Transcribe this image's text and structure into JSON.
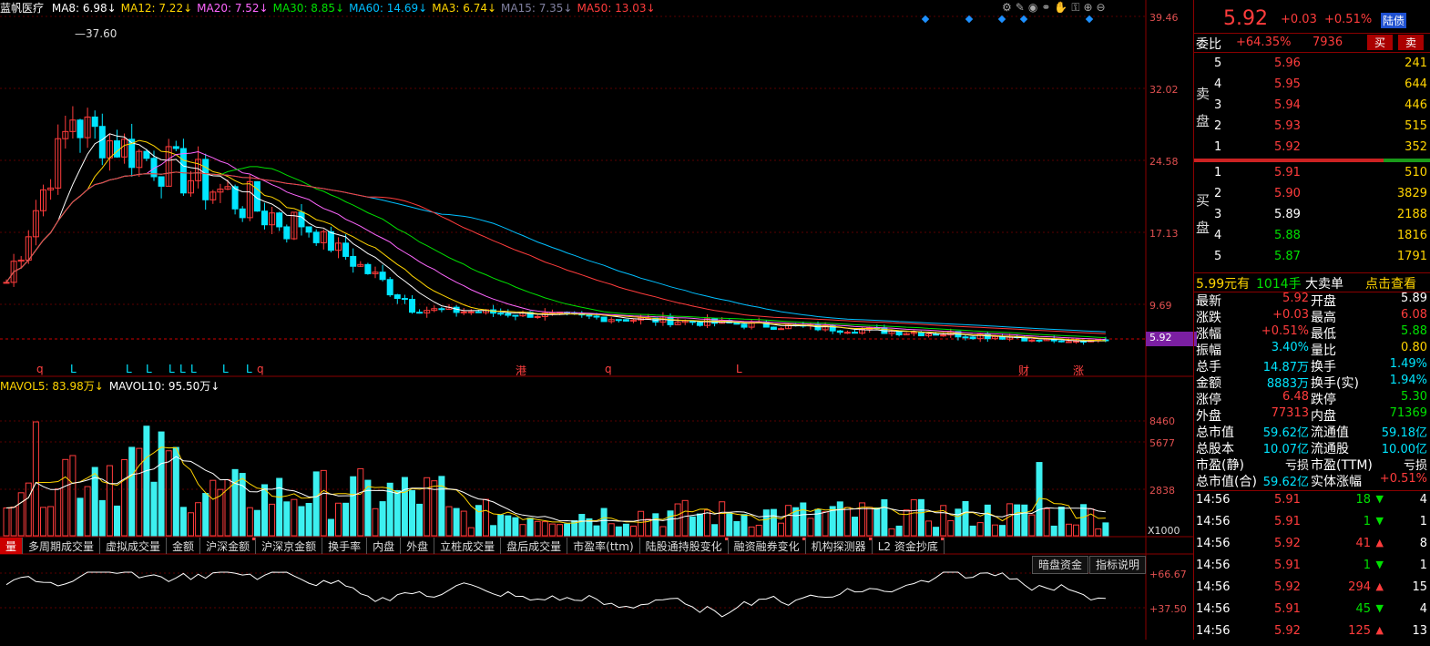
{
  "ma_bar": {
    "stock": "蓝帆医疗",
    "items": [
      {
        "label": "MA8: 6.98↓",
        "color": "#ffffff"
      },
      {
        "label": "MA12: 7.22↓",
        "color": "#ffd400"
      },
      {
        "label": "MA20: 7.52↓",
        "color": "#ff66ff"
      },
      {
        "label": "MA30: 8.85↓",
        "color": "#00e000"
      },
      {
        "label": "MA60: 14.69↓",
        "color": "#00bfff"
      },
      {
        "label": "MA3: 6.74↓",
        "color": "#ffd400"
      },
      {
        "label": "MA15: 7.35↓",
        "color": "#8080a0"
      },
      {
        "label": "MA50: 13.03↓",
        "color": "#ff3c3c"
      }
    ]
  },
  "toolbar_icons": [
    "settings-icon",
    "brush-icon",
    "eye-icon",
    "link-icon",
    "hand-icon",
    "lock-icon",
    "zoom-in-icon",
    "zoom-out-icon"
  ],
  "price_axis": [
    "39.46",
    "32.02",
    "24.58",
    "17.13",
    "9.69",
    "5.92"
  ],
  "peak_label": "37.60",
  "current_price_tag": "5.92",
  "event_markers": [
    {
      "text": "q",
      "color": "#ff4040"
    },
    {
      "text": "L",
      "color": "#00e5ff"
    },
    {
      "text": "L",
      "color": "#00e5ff"
    },
    {
      "text": "L",
      "color": "#00e5ff"
    },
    {
      "text": "L",
      "color": "#00e5ff"
    },
    {
      "text": "L",
      "color": "#00e5ff"
    },
    {
      "text": "L",
      "color": "#00e5ff"
    },
    {
      "text": "L",
      "color": "#00e5ff"
    },
    {
      "text": "L",
      "color": "#00e5ff"
    },
    {
      "text": "q",
      "color": "#ff4040"
    },
    {
      "text": "港",
      "color": "#ff4040"
    },
    {
      "text": "q",
      "color": "#ff4040"
    },
    {
      "text": "L",
      "color": "#ff4040"
    },
    {
      "text": "财",
      "color": "#ff4040"
    },
    {
      "text": "涨",
      "color": "#ff4040"
    }
  ],
  "vol_bar": {
    "items": [
      {
        "label": "MAVOL5: 83.98万↓",
        "color": "#ffd400"
      },
      {
        "label": "MAVOL10: 95.50万↓",
        "color": "#ffffff"
      }
    ]
  },
  "vol_axis": [
    "8460",
    "5677",
    "2838",
    "X1000"
  ],
  "tabs": [
    {
      "label": "量",
      "active": true
    },
    {
      "label": "多周期成交量"
    },
    {
      "label": "虚拟成交量"
    },
    {
      "label": "金额"
    },
    {
      "label": "沪深金额",
      "dot": true
    },
    {
      "label": "沪深京金额"
    },
    {
      "label": "换手率"
    },
    {
      "label": "内盘"
    },
    {
      "label": "外盘"
    },
    {
      "label": "立桩成交量"
    },
    {
      "label": "盘后成交量"
    },
    {
      "label": "市盈率(ttm)"
    },
    {
      "label": "陆股通持股变化",
      "dot": true
    },
    {
      "label": "融资融券变化",
      "dot": true
    },
    {
      "label": "机构探测器",
      "dot": true
    },
    {
      "label": "L2 资金抄底",
      "dot": true
    }
  ],
  "sub_buttons": {
    "dark_pool": "暗盘资金",
    "indicator_help": "指标说明"
  },
  "sub_axis": [
    "+66.67",
    "+37.50"
  ],
  "quote": {
    "price": "5.92",
    "change": "+0.03",
    "pct": "+0.51%",
    "tag": "陆债",
    "weibi_label": "委比",
    "weibi": "+64.35%",
    "weicha": "7936",
    "buy_btn": "买",
    "sell_btn": "卖",
    "sell_label": [
      "卖",
      "盘"
    ],
    "buy_label": [
      "买",
      "盘"
    ],
    "asks": [
      {
        "lvl": "5",
        "price": "5.96",
        "vol": "241"
      },
      {
        "lvl": "4",
        "price": "5.95",
        "vol": "644"
      },
      {
        "lvl": "3",
        "price": "5.94",
        "vol": "446"
      },
      {
        "lvl": "2",
        "price": "5.93",
        "vol": "515"
      },
      {
        "lvl": "1",
        "price": "5.92",
        "vol": "352"
      }
    ],
    "bids": [
      {
        "lvl": "1",
        "price": "5.91",
        "vol": "510"
      },
      {
        "lvl": "2",
        "price": "5.90",
        "vol": "3829"
      },
      {
        "lvl": "3",
        "price": "5.89",
        "vol": "2188"
      },
      {
        "lvl": "4",
        "price": "5.88",
        "vol": "1816"
      },
      {
        "lvl": "5",
        "price": "5.87",
        "vol": "1791"
      }
    ],
    "big_order": {
      "price": "5.99元有",
      "lots": "1014手",
      "kind": "大卖单",
      "link": "点击查看"
    },
    "stats": [
      {
        "l1": "最新",
        "v1": "5.92",
        "c1": "red",
        "l2": "开盘",
        "v2": "5.89",
        "c2": "white"
      },
      {
        "l1": "涨跌",
        "v1": "+0.03",
        "c1": "red",
        "l2": "最高",
        "v2": "6.08",
        "c2": "red"
      },
      {
        "l1": "涨幅",
        "v1": "+0.51%",
        "c1": "red",
        "l2": "最低",
        "v2": "5.88",
        "c2": "green"
      },
      {
        "l1": "振幅",
        "v1": "3.40%",
        "c1": "cyan",
        "l2": "量比",
        "v2": "0.80",
        "c2": "yellow"
      },
      {
        "l1": "总手",
        "v1": "14.87万",
        "c1": "cyan",
        "l2": "换手",
        "v2": "1.49%",
        "c2": "cyan"
      },
      {
        "l1": "金额",
        "v1": "8883万",
        "c1": "cyan",
        "l2": "换手(实)",
        "v2": "1.94%",
        "c2": "cyan"
      },
      {
        "l1": "涨停",
        "v1": "6.48",
        "c1": "red",
        "l2": "跌停",
        "v2": "5.30",
        "c2": "green"
      },
      {
        "l1": "外盘",
        "v1": "77313",
        "c1": "red",
        "l2": "内盘",
        "v2": "71369",
        "c2": "green"
      },
      {
        "l1": "总市值",
        "v1": "59.62亿",
        "c1": "cyan",
        "l2": "流通值",
        "v2": "59.18亿",
        "c2": "cyan"
      },
      {
        "l1": "总股本",
        "v1": "10.07亿",
        "c1": "cyan",
        "l2": "流通股",
        "v2": "10.00亿",
        "c2": "cyan"
      },
      {
        "l1": "市盈(静)",
        "v1": "亏损",
        "c1": "white",
        "l2": "市盈(TTM)",
        "v2": "亏损",
        "c2": "white"
      },
      {
        "l1": "总市值(合)",
        "v1": "59.62亿",
        "c1": "cyan",
        "l2": "实体涨幅",
        "v2": "+0.51%",
        "c2": "red"
      }
    ],
    "trades": [
      {
        "time": "14:56",
        "price": "5.91",
        "pc": "red",
        "vol": "18",
        "dir": "down",
        "n": "4"
      },
      {
        "time": "14:56",
        "price": "5.91",
        "pc": "red",
        "vol": "1",
        "dir": "down",
        "n": "1"
      },
      {
        "time": "14:56",
        "price": "5.92",
        "pc": "red",
        "vol": "41",
        "dir": "up",
        "n": "8"
      },
      {
        "time": "14:56",
        "price": "5.91",
        "pc": "red",
        "vol": "1",
        "dir": "down",
        "n": "1"
      },
      {
        "time": "14:56",
        "price": "5.92",
        "pc": "red",
        "vol": "294",
        "dir": "up",
        "n": "15"
      },
      {
        "time": "14:56",
        "price": "5.91",
        "pc": "red",
        "vol": "45",
        "dir": "down",
        "n": "4"
      },
      {
        "time": "14:56",
        "price": "5.92",
        "pc": "red",
        "vol": "125",
        "dir": "up",
        "n": "13"
      }
    ]
  }
}
